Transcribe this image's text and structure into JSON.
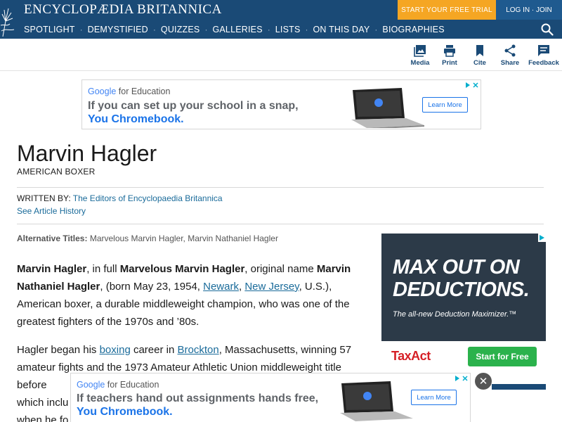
{
  "header": {
    "brand": "ENCYCLOPÆDIA BRITANNICA",
    "trial_button": "START YOUR FREE TRIAL",
    "login_button": "LOG IN · JOIN",
    "nav": [
      "SPOTLIGHT",
      "DEMYSTIFIED",
      "QUIZZES",
      "GALLERIES",
      "LISTS",
      "ON THIS DAY",
      "BIOGRAPHIES"
    ],
    "nav_separator": "·",
    "colors": {
      "nav_bg": "#1a4a76",
      "trial_bg": "#f5a623"
    }
  },
  "toolbar": {
    "media": "Media",
    "print": "Print",
    "cite": "Cite",
    "share": "Share",
    "feedback": "Feedback"
  },
  "ad_top": {
    "brand_google": "Google",
    "brand_rest": " for Education",
    "headline": "If you can set up your school in a snap,",
    "tagline": "You Chromebook.",
    "button": "Learn More"
  },
  "article": {
    "title": "Marvin Hagler",
    "subtitle": "AMERICAN BOXER",
    "written_label": "WRITTEN BY:",
    "written_by": "The Editors of Encyclopaedia Britannica",
    "history_link": "See Article History",
    "alt_label": "Alternative Titles:",
    "alt_titles": "Marvelous Marvin Hagler, Marvin Nathaniel Hagler",
    "p1": {
      "s1": "Marvin Hagler",
      "s2": ", in full ",
      "s3": "Marvelous Marvin Hagler",
      "s4": ", original name ",
      "s5": "Marvin Nathaniel Hagler",
      "s6": ", (born May 23, 1954, ",
      "link1": "Newark",
      "s7": ", ",
      "link2": "New Jersey",
      "s8": ", U.S.), American boxer, a durable middleweight champion, who was one of the greatest fighters of the 1970s and ’80s."
    },
    "p2": {
      "s1": "Hagler began his ",
      "link1": "boxing",
      "s2": " career in ",
      "link2": "Brockton",
      "s3": ", Massachusetts, winning 57 amateur fights and the 1973 Amateur Athletic Union middleweight title before",
      "s4": "which inclu",
      "s5": "when he fo"
    }
  },
  "ad_side": {
    "headline1": "MAX OUT ON",
    "headline2": "DEDUCTIONS.",
    "subline": "The all-new Deduction Maximizer.™",
    "logo": "TaxAct",
    "button": "Start for Free"
  },
  "ad_bottom": {
    "brand_google": "Google",
    "brand_rest": " for Education",
    "headline": "If teachers hand out assignments hands free,",
    "tagline": "You Chromebook.",
    "button": "Learn More",
    "close": "✕"
  }
}
